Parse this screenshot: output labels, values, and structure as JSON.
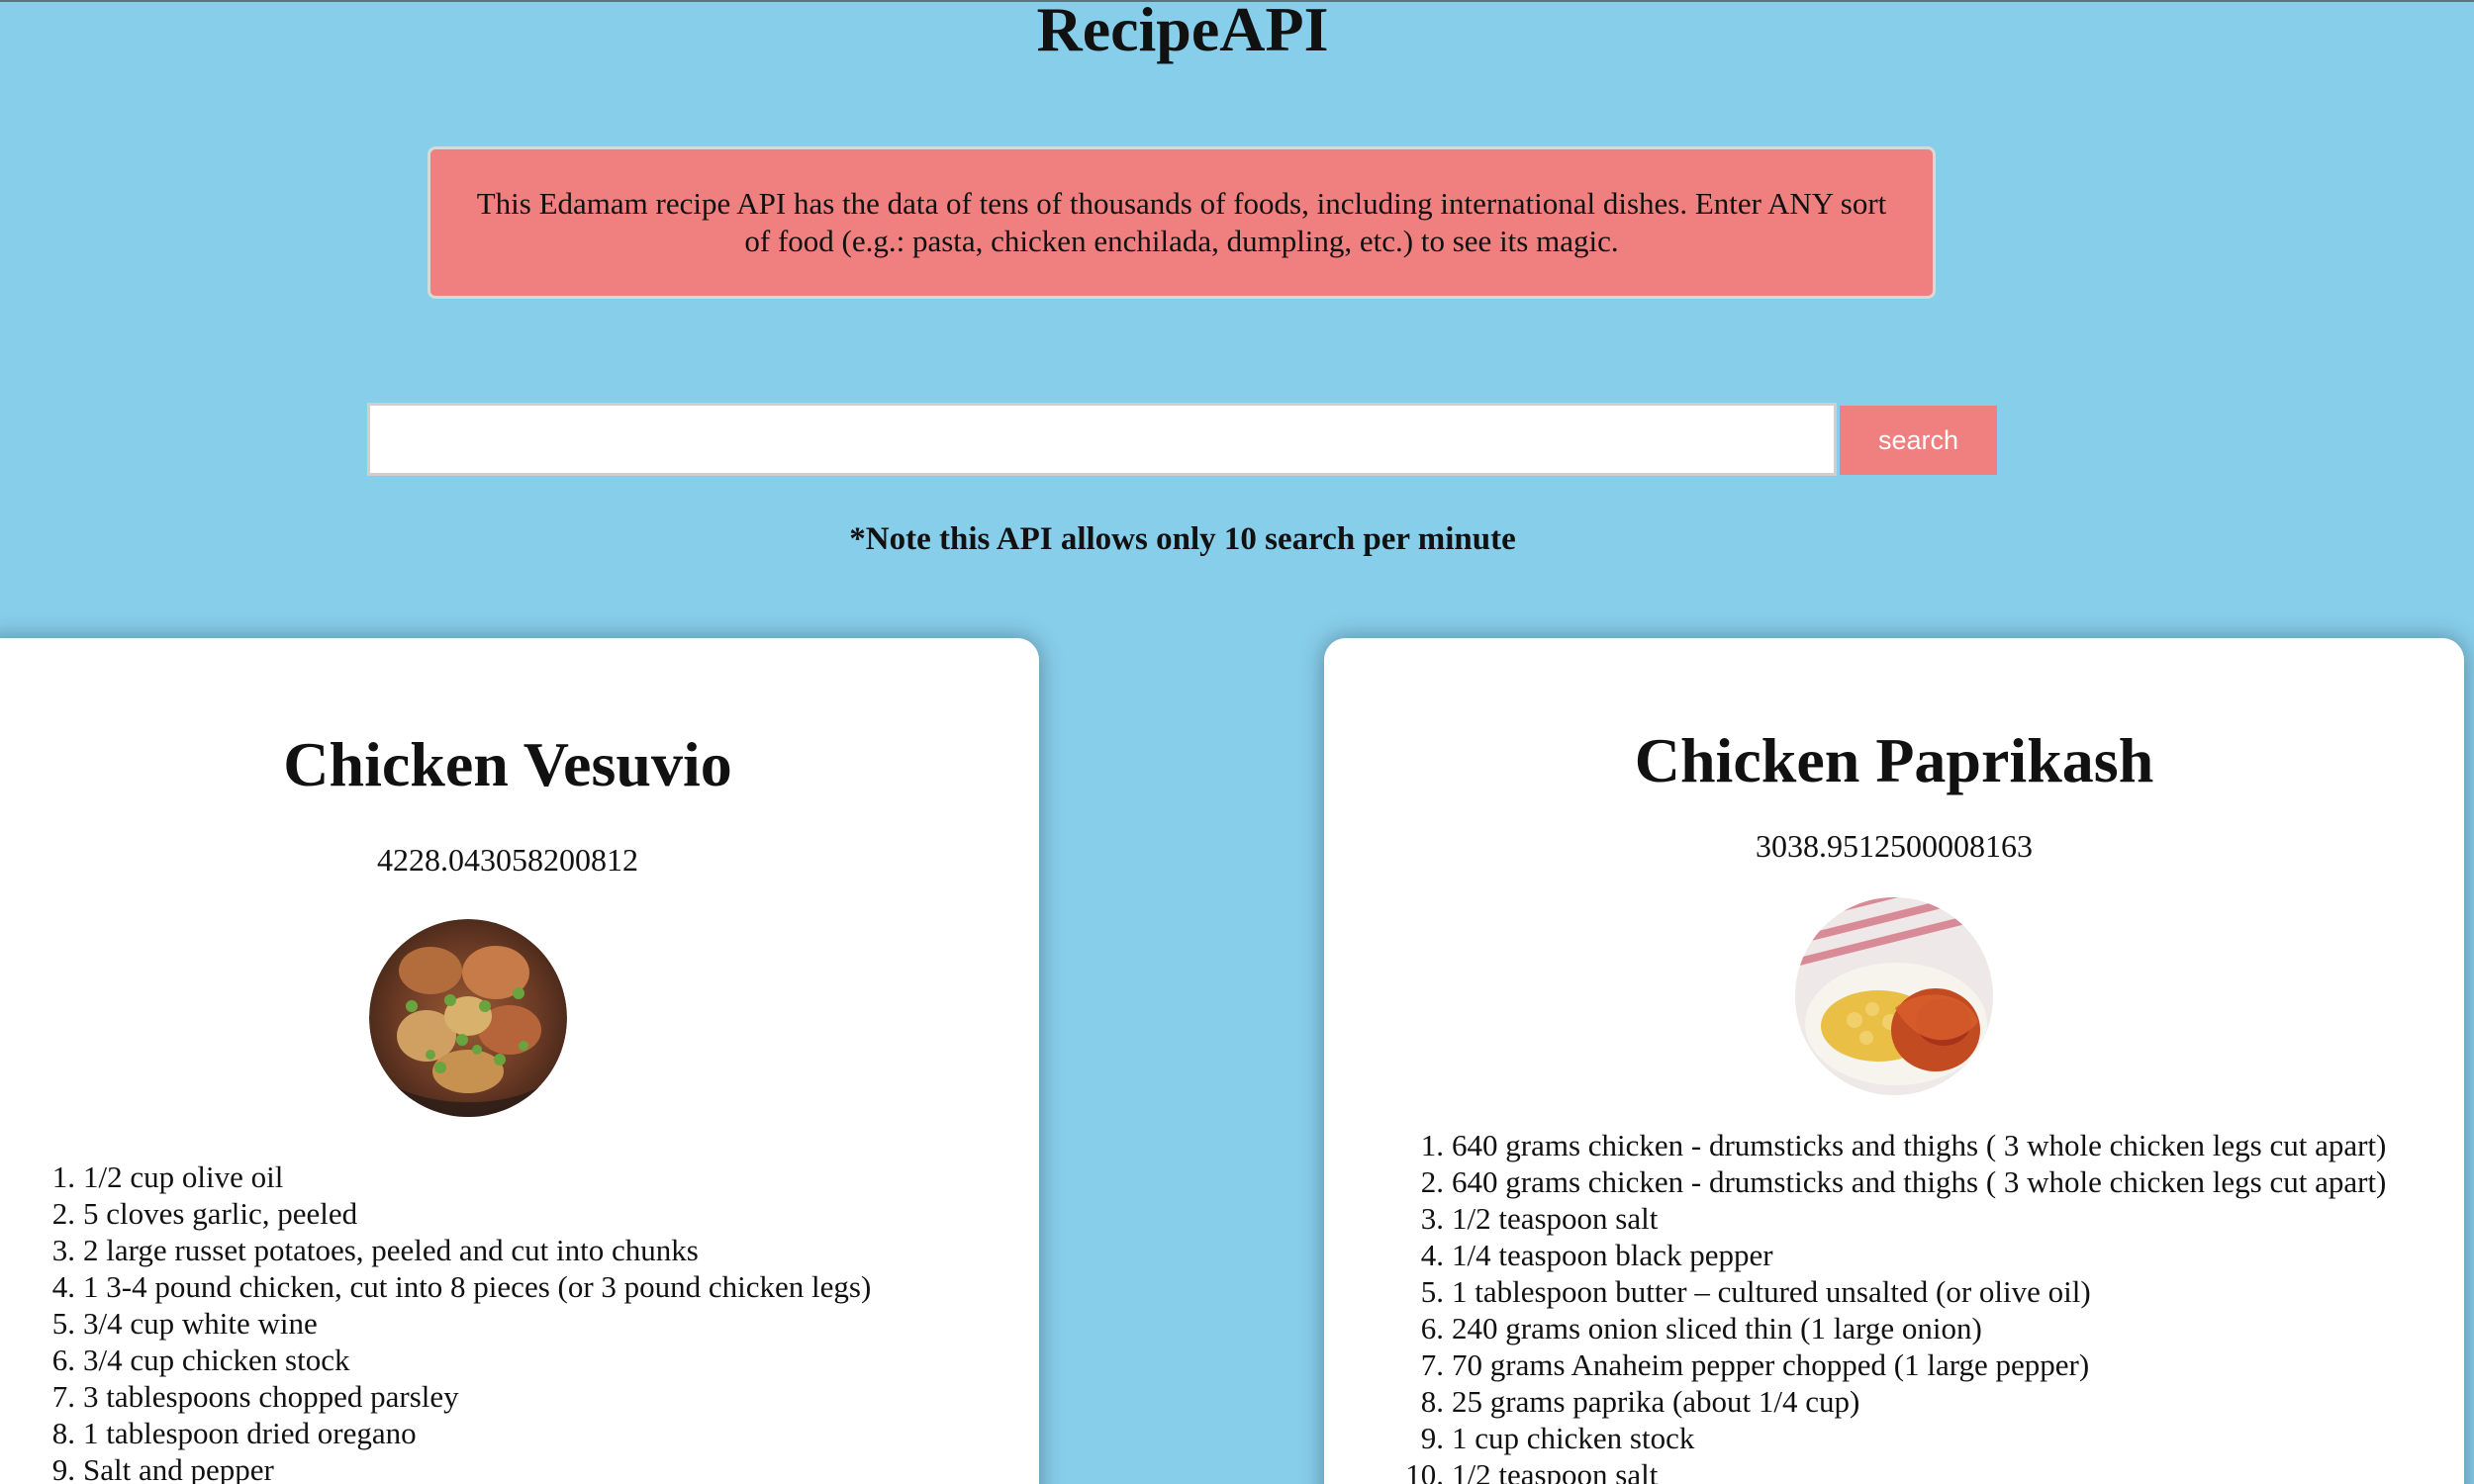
{
  "app": {
    "title": "RecipeAPI"
  },
  "info": {
    "message": "This Edamam recipe API has the data of tens of thousands of foods, including international dishes. Enter ANY sort of food (e.g.: pasta, chicken enchilada, dumpling, etc.) to see its magic."
  },
  "search": {
    "value": "",
    "placeholder": "",
    "button_label": "search"
  },
  "note": {
    "text": "*Note this API allows only 10 search per minute"
  },
  "recipes": [
    {
      "title": "Chicken Vesuvio",
      "calories": "4228.043058200812",
      "image_icon": "chicken-vesuvio-image",
      "ingredients": [
        {
          "num": "1.",
          "text": "1/2 cup olive oil"
        },
        {
          "num": "2.",
          "text": "5 cloves garlic, peeled"
        },
        {
          "num": "3.",
          "text": "2 large russet potatoes, peeled and cut into chunks"
        },
        {
          "num": "4.",
          "text": "1 3-4 pound chicken, cut into 8 pieces (or 3 pound chicken legs)"
        },
        {
          "num": "5.",
          "text": "3/4 cup white wine"
        },
        {
          "num": "6.",
          "text": "3/4 cup chicken stock"
        },
        {
          "num": "7.",
          "text": "3 tablespoons chopped parsley"
        },
        {
          "num": "8.",
          "text": "1 tablespoon dried oregano"
        },
        {
          "num": "9.",
          "text": "Salt and pepper"
        }
      ]
    },
    {
      "title": "Chicken Paprikash",
      "calories": "3038.9512500008163",
      "image_icon": "chicken-paprikash-image",
      "ingredients": [
        {
          "num": "1.",
          "text": "640 grams chicken - drumsticks and thighs ( 3 whole chicken legs cut apart)"
        },
        {
          "num": "2.",
          "text": "640 grams chicken - drumsticks and thighs ( 3 whole chicken legs cut apart)"
        },
        {
          "num": "3.",
          "text": "1/2 teaspoon salt"
        },
        {
          "num": "4.",
          "text": "1/4 teaspoon black pepper"
        },
        {
          "num": "5.",
          "text": "1 tablespoon butter – cultured unsalted (or olive oil)"
        },
        {
          "num": "6.",
          "text": "240 grams onion sliced thin (1 large onion)"
        },
        {
          "num": "7.",
          "text": "70 grams Anaheim pepper chopped (1 large pepper)"
        },
        {
          "num": "8.",
          "text": "25 grams paprika (about 1/4 cup)"
        },
        {
          "num": "9.",
          "text": "1 cup chicken stock"
        },
        {
          "num": "10.",
          "text": "1/2 teaspoon salt"
        }
      ]
    }
  ],
  "colors": {
    "background": "#87ceeb",
    "accent": "#f07f7f",
    "card": "#ffffff"
  }
}
